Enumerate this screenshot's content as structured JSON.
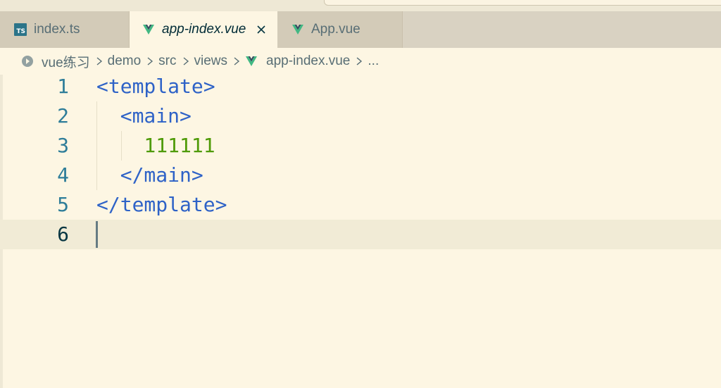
{
  "tabs": [
    {
      "label": "index.ts",
      "icon": "typescript-file-icon",
      "icon_text": "TS",
      "active": false
    },
    {
      "label": "app-index.vue",
      "icon": "vue-file-icon",
      "active": true
    },
    {
      "label": "App.vue",
      "icon": "vue-file-icon",
      "active": false
    }
  ],
  "breadcrumb": {
    "items": [
      "vue练习",
      "demo",
      "src",
      "views",
      "app-index.vue",
      "..."
    ]
  },
  "editor": {
    "lines": [
      {
        "number": "1",
        "code": "<template>"
      },
      {
        "number": "2",
        "code": "  <main>"
      },
      {
        "number": "3",
        "code": "    111111"
      },
      {
        "number": "4",
        "code": "  </main>"
      },
      {
        "number": "5",
        "code": "</template>"
      },
      {
        "number": "6",
        "code": ""
      }
    ],
    "current_line": "6"
  },
  "colors": {
    "background": "#FDF6E3",
    "tag": "#2E62C7",
    "text": "#4E9A06",
    "line_number": "#2E7D99",
    "vue_green": "#41B883"
  }
}
